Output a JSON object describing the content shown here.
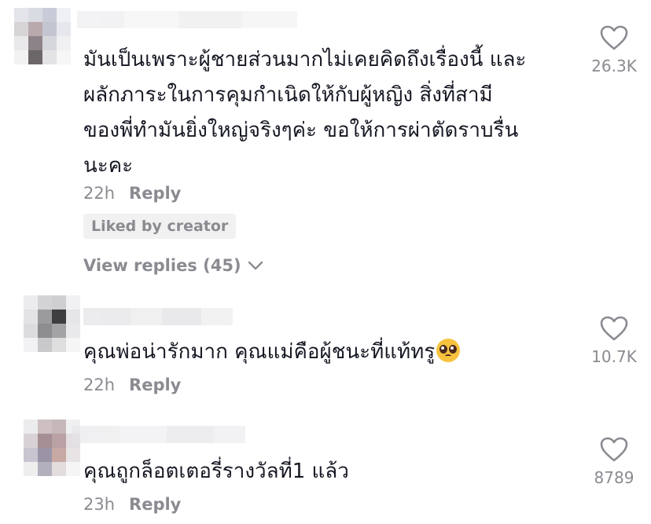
{
  "comments": [
    {
      "text_lines": [
        "มันเป็นเพราะผู้ชายส่วนมากไม่เคยคิดถึงเรื่องนี้ และ",
        "ผลักภาระในการคุมกำเนิดให้กับผู้หญิง สิ่งที่สามี",
        "ของพี่ทำมันยิ่งใหญ่จริงๆค่ะ ขอให้การผ่าตัดราบรื่น",
        "นะคะ"
      ],
      "time": "22h",
      "reply_label": "Reply",
      "liked_by_creator": "Liked by creator",
      "view_replies": "View replies (45)",
      "like_count": "26.3K",
      "like_icon": "heart-outline-icon"
    },
    {
      "text": "คุณพ่อน่ารักมาก คุณแม่คือผู้ชนะที่แท้ทรู",
      "emoji": "pleading-face-emoji",
      "time": "22h",
      "reply_label": "Reply",
      "like_count": "10.7K",
      "like_icon": "heart-outline-icon"
    },
    {
      "text": "คุณถูกล็อตเตอรี่รางวัลที่1 แล้ว",
      "time": "23h",
      "reply_label": "Reply",
      "like_count": "8789",
      "like_icon": "heart-outline-icon"
    }
  ],
  "colors": {
    "text_primary": "#161823",
    "text_secondary": "#8a8b91",
    "badge_bg": "#f1f1f2",
    "background": "#ffffff"
  }
}
